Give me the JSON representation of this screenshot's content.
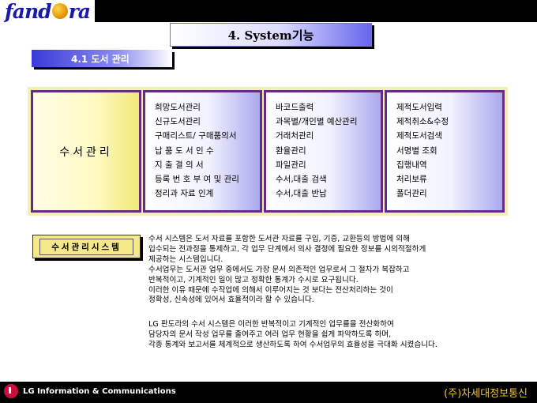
{
  "header": {
    "logo_text_a": "fand",
    "logo_text_b": "ra",
    "title": "4. System기능"
  },
  "subtitle": "4.1 도서 관리",
  "main_box": {
    "label": "수서관리"
  },
  "columns": [
    {
      "items": [
        "희망도서관리",
        "신규도서관리",
        "구매리스트/ 구매품의서",
        "납 품 도 서 인 수",
        "지 출 결 의 서",
        "등록 번 호 부 여 및 관리",
        "정리과 자료 인계"
      ]
    },
    {
      "items": [
        "바코드출력",
        "과목별/개인별 예산관리",
        "거래처관리",
        "환율관리",
        "파일관리",
        "수서,대출 검색",
        "수서,대출 반납"
      ]
    },
    {
      "items": [
        "제적도서입력",
        "제적취소&수정",
        "제적도서검색",
        "서명별 조회",
        "집행내역",
        "처리보류",
        "폴더관리"
      ]
    }
  ],
  "system_tag": "수서관리시스템",
  "description": {
    "paragraph1": [
      "수서 시스템은 도서 자료를 포함한 도서관 자료를 구입, 기증, 교환등의 방법에 의해",
      "입수되는 전과정을 통제하고, 각 업무 단계에서 의사 결정에 필요한 정보를 시의적절하게",
      "제공하는 시스템입니다.",
      "수서업무는 도서관 업무 중에서도 가장 문서 의존적인 업무로서 그 절차가 복잡하고",
      "반복적이고, 기계적인 일이 많고 정확한 통계가 수시로 요구됩니다.",
      "이러한 이유 때문에 수작업에 의해서 이루어지는 것 보다는 전산처리하는 것이",
      "정확성, 신속성에 있어서 효율적이라 할 수 있습니다."
    ],
    "paragraph2": [
      "LG 판도라의 수서 시스템은 이러한 반복적이고 기계적인 업무를을 전산화하여",
      "담당자의 문서 작성 업무를 줄여주고 여러 업무 현황을 쉽게 파악하도록 하며,",
      "각종 통계와 보고서를 체계적으로 생산하도록 하여 수서업무의 효율성을 극대화 시켰습니다."
    ]
  },
  "footer": {
    "company_left": "LG Information & Communications",
    "company_right": "(주)차세대정보통신"
  },
  "colors": {
    "title_gradient_end": "#6666ee",
    "box_border": "#6a2a82",
    "frame_bg": "#f4f0b4",
    "footer_right_text": "#f0c23a"
  }
}
